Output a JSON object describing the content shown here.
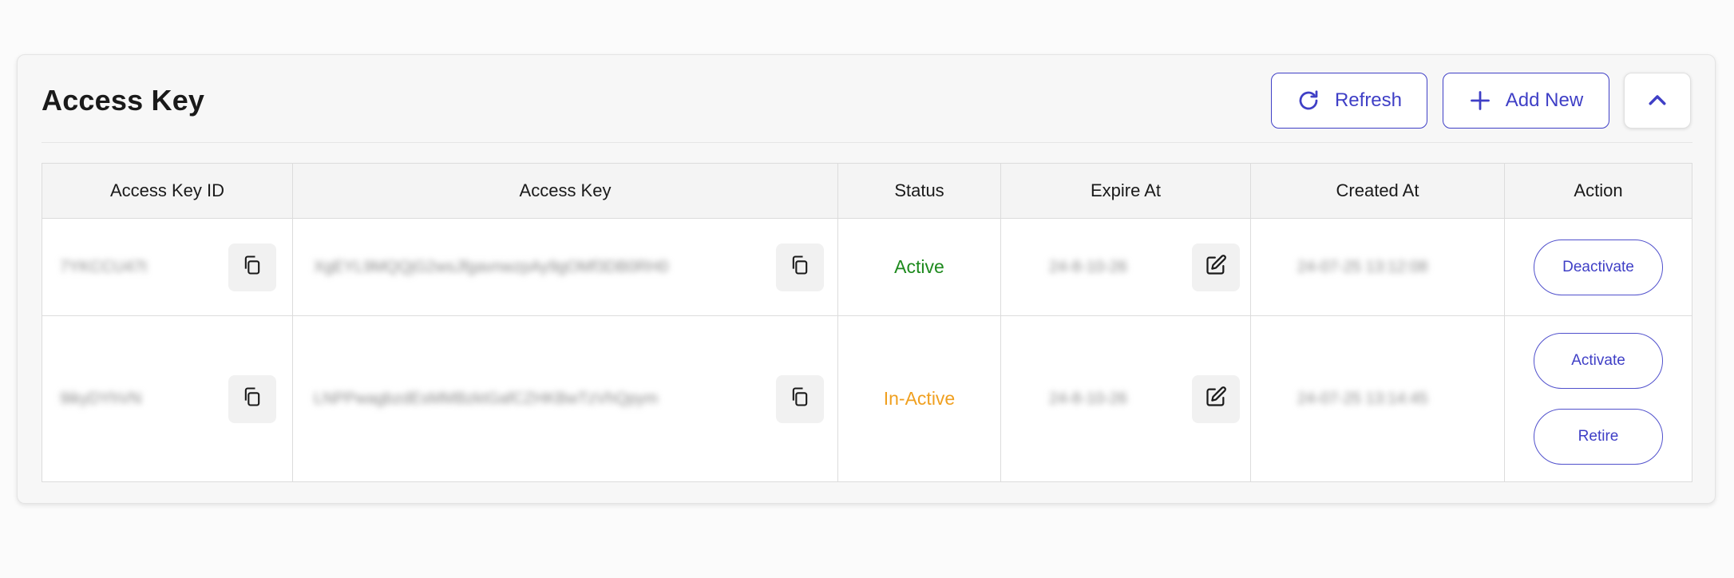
{
  "panel": {
    "title": "Access Key",
    "refresh_label": "Refresh",
    "add_label": "Add New"
  },
  "table": {
    "headers": [
      "Access Key ID",
      "Access Key",
      "Status",
      "Expire At",
      "Created At",
      "Action"
    ],
    "rows": [
      {
        "key_id": "7YKCCU47t",
        "access_key": "XgEYL9MQQjG2wsJfgavnwzpAy9gOMf3DB0RH0",
        "status": "Active",
        "expire_at": "24-8-10-26",
        "created_at": "24-07-25 13:12:08",
        "actions": [
          "Deactivate"
        ]
      },
      {
        "key_id": "9ikyDYhVN",
        "access_key": "LNPPwagbzdEsMMBzktGafCZHKBwTzVhQpym",
        "status": "In-Active",
        "expire_at": "24-8-10-26",
        "created_at": "24-07-25 13:14:45",
        "actions": [
          "Activate",
          "Retire"
        ]
      }
    ]
  },
  "colors": {
    "accent": "#3f3fc6",
    "status_active": "#1e8a1e",
    "status_inactive": "#f0a020"
  },
  "icons": [
    "refresh-icon",
    "plus-icon",
    "chevron-up-icon",
    "copy-icon",
    "edit-icon"
  ]
}
